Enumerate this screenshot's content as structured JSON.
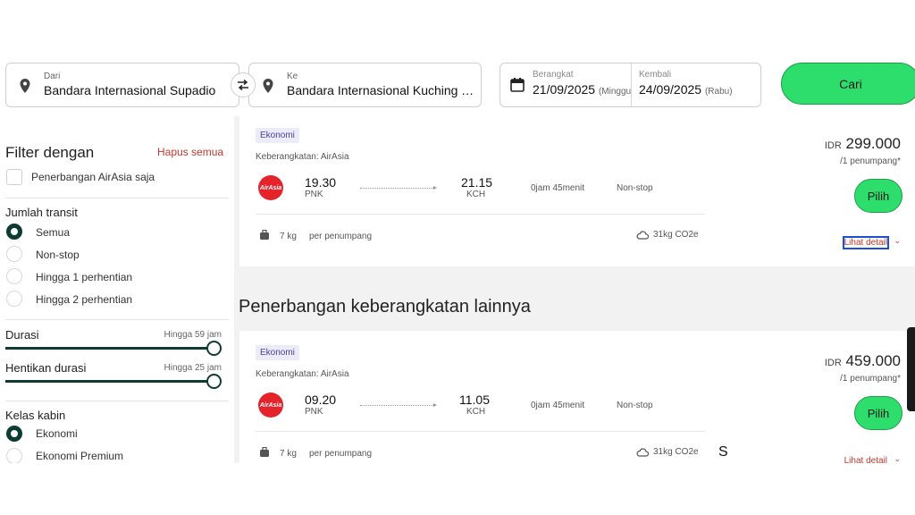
{
  "search": {
    "from_label": "Dari",
    "from_value": "Bandara Internasional Supadio",
    "to_label": "Ke",
    "to_value": "Bandara Internasional Kuching Te...",
    "depart_label": "Berangkat",
    "depart_date": "21/09/2025",
    "depart_day": "(Minggu)",
    "return_label": "Kembali",
    "return_date": "24/09/2025",
    "return_day": "(Rabu)",
    "search_button": "Cari"
  },
  "filters": {
    "title": "Filter dengan",
    "clear_all": "Hapus semua",
    "airasia_only": "Penerbangan AirAsia saja",
    "transit_heading": "Jumlah transit",
    "transit_options": [
      {
        "label": "Semua",
        "selected": true
      },
      {
        "label": "Non-stop",
        "selected": false
      },
      {
        "label": "Hingga 1 perhentian",
        "selected": false
      },
      {
        "label": "Hingga 2 perhentian",
        "selected": false
      }
    ],
    "duration_label": "Durasi",
    "duration_value": "Hingga 59 jam",
    "stop_duration_label": "Hentikan durasi",
    "stop_duration_value": "Hingga 25 jam",
    "cabin_heading": "Kelas kabin",
    "cabin_options": [
      {
        "label": "Ekonomi",
        "selected": true
      },
      {
        "label": "Ekonomi Premium",
        "selected": false
      }
    ]
  },
  "section_title": "Penerbangan keberangkatan lainnya",
  "flights": [
    {
      "cabin": "Ekonomi",
      "operator": "Keberangkatan: AirAsia",
      "logo_text": "AirAsia",
      "depart_time": "19.30",
      "depart_code": "PNK",
      "arrive_time": "21.15",
      "arrive_code": "KCH",
      "duration": "0jam 45menit",
      "stops": "Non-stop",
      "baggage": "7 kg",
      "baggage_note": "per penumpang",
      "co2": "31kg CO2e",
      "currency": "IDR",
      "price": "299.000",
      "per": "/1 penumpang*",
      "select": "Pilih",
      "detail": "Lihat detail",
      "chevron": "⌄"
    },
    {
      "cabin": "Ekonomi",
      "operator": "Keberangkatan: AirAsia",
      "logo_text": "AirAsia",
      "depart_time": "09.20",
      "depart_code": "PNK",
      "arrive_time": "11.05",
      "arrive_code": "KCH",
      "duration": "0jam 45menit",
      "stops": "Non-stop",
      "baggage": "7 kg",
      "baggage_note": "per penumpang",
      "co2": "31kg CO2e",
      "currency": "IDR",
      "price": "459.000",
      "per": "/1 penumpang*",
      "select": "Pilih",
      "detail": "Lihat detail",
      "chevron": "⌄"
    }
  ],
  "stray_text": "S",
  "colors": {
    "accent": "#2dde6d",
    "dark": "#0f3b35",
    "link": "#c0392b",
    "brand": "#e4232b"
  }
}
